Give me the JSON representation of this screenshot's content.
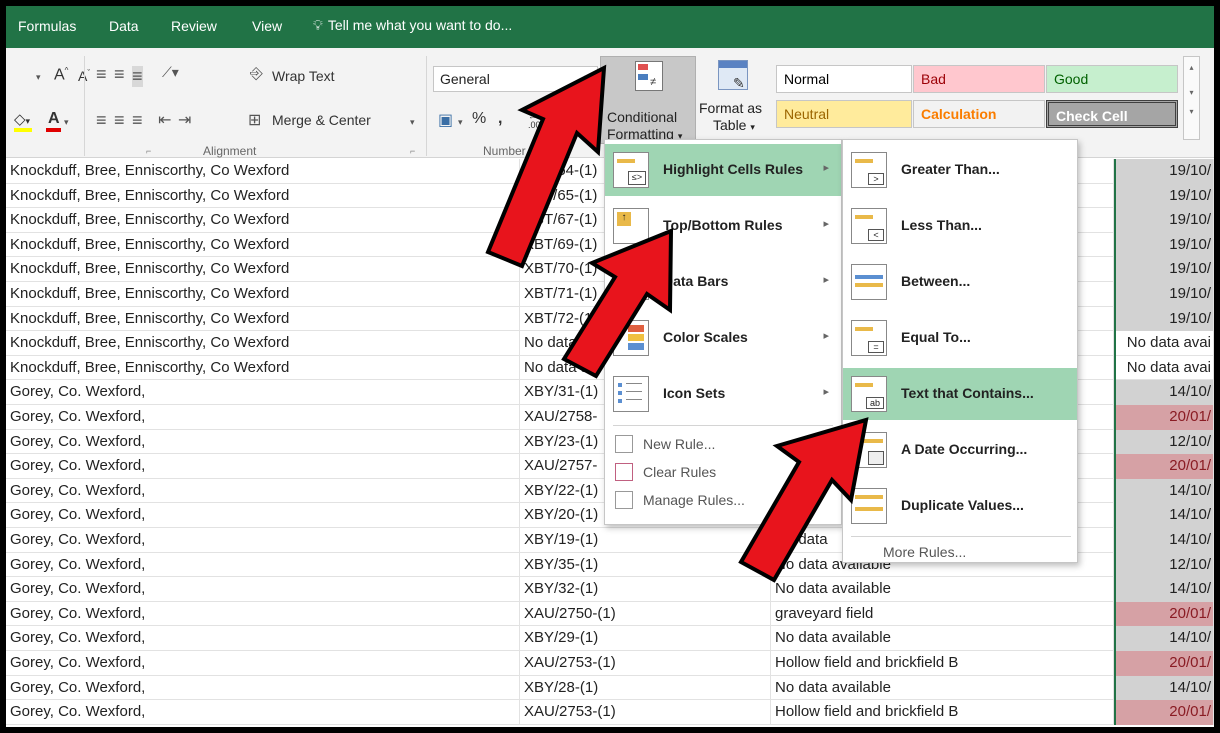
{
  "tabs": [
    "Formulas",
    "Data",
    "Review",
    "View"
  ],
  "tell_me": "Tell me what you want to do...",
  "ribbon": {
    "wrap_text": "Wrap Text",
    "merge_center": "Merge & Center",
    "number_format": "General",
    "cf_label_1": "Conditional",
    "cf_label_2": "Formatting",
    "fat_label_1": "Format as",
    "fat_label_2": "Table",
    "alignment_group": "Alignment",
    "number_group": "Number",
    "percent": "%",
    "comma": ","
  },
  "styles": [
    {
      "label": "Normal",
      "bg": "#ffffff",
      "fg": "#000000"
    },
    {
      "label": "Bad",
      "bg": "#ffc7ce",
      "fg": "#9c0006"
    },
    {
      "label": "Good",
      "bg": "#c6efce",
      "fg": "#006100"
    },
    {
      "label": "Neutral",
      "bg": "#ffeb9c",
      "fg": "#9c6500"
    },
    {
      "label": "Calculation",
      "bg": "#f2f2f2",
      "fg": "#fa7d00"
    },
    {
      "label": "Check Cell",
      "bg": "#a5a5a5",
      "fg": "#ffffff"
    }
  ],
  "menu1": {
    "items": [
      {
        "label": "Highlight Cells Rules",
        "icon": "highlight-cells-icon"
      },
      {
        "label": "Top/Bottom Rules",
        "icon": "top-bottom-icon"
      },
      {
        "label": "Data Bars",
        "icon": "data-bars-icon"
      },
      {
        "label": "Color Scales",
        "icon": "color-scales-icon"
      },
      {
        "label": "Icon Sets",
        "icon": "icon-sets-icon"
      }
    ],
    "small": [
      "New Rule...",
      "Clear Rules",
      "Manage Rules..."
    ]
  },
  "menu2": {
    "items": [
      {
        "label": "Greater Than..."
      },
      {
        "label": "Less Than..."
      },
      {
        "label": "Between..."
      },
      {
        "label": "Equal To..."
      },
      {
        "label": "Text that Contains..."
      },
      {
        "label": "A Date Occurring..."
      },
      {
        "label": "Duplicate Values..."
      }
    ],
    "more": "More Rules..."
  },
  "rows": [
    {
      "a": "Knockduff, Bree, Enniscorthy, Co Wexford",
      "b": "XBT/64-(1)",
      "c": "",
      "d": "19/10/",
      "t": "gray"
    },
    {
      "a": "Knockduff, Bree, Enniscorthy, Co Wexford",
      "b": "XBT/65-(1)",
      "c": "",
      "d": "19/10/",
      "t": "gray"
    },
    {
      "a": "Knockduff, Bree, Enniscorthy, Co Wexford",
      "b": "XBT/67-(1)",
      "c": "",
      "d": "19/10/",
      "t": "gray"
    },
    {
      "a": "Knockduff, Bree, Enniscorthy, Co Wexford",
      "b": "XBT/69-(1)",
      "c": "",
      "d": "19/10/",
      "t": "gray"
    },
    {
      "a": "Knockduff, Bree, Enniscorthy, Co Wexford",
      "b": "XBT/70-(1)",
      "c": "",
      "d": "19/10/",
      "t": "gray"
    },
    {
      "a": "Knockduff, Bree, Enniscorthy, Co Wexford",
      "b": "XBT/71-(1)",
      "c": "",
      "d": "19/10/",
      "t": "gray"
    },
    {
      "a": "Knockduff, Bree, Enniscorthy, Co Wexford",
      "b": "XBT/72-(1)",
      "c": "",
      "d": "19/10/",
      "t": "gray"
    },
    {
      "a": "Knockduff, Bree, Enniscorthy, Co Wexford",
      "b": "No data av",
      "c": "",
      "d": "No data avai",
      "t": ""
    },
    {
      "a": "Knockduff, Bree, Enniscorthy, Co Wexford",
      "b": "No data av",
      "c": "",
      "d": "No data avai",
      "t": ""
    },
    {
      "a": "Gorey, Co. Wexford,",
      "b": "XBY/31-(1)",
      "c": "",
      "d": "14/10/",
      "t": "gray"
    },
    {
      "a": "Gorey, Co. Wexford,",
      "b": "XAU/2758-",
      "c": "",
      "d": "20/01/",
      "t": "red"
    },
    {
      "a": "Gorey, Co. Wexford,",
      "b": "XBY/23-(1)",
      "c": "",
      "d": "12/10/",
      "t": "gray"
    },
    {
      "a": "Gorey, Co. Wexford,",
      "b": "XAU/2757-",
      "c": "",
      "d": "20/01/",
      "t": "red"
    },
    {
      "a": "Gorey, Co. Wexford,",
      "b": "XBY/22-(1)",
      "c": "",
      "d": "14/10/",
      "t": "gray"
    },
    {
      "a": "Gorey, Co. Wexford,",
      "b": "XBY/20-(1)",
      "c": "No data",
      "d": "14/10/",
      "t": "gray"
    },
    {
      "a": "Gorey, Co. Wexford,",
      "b": "XBY/19-(1)",
      "c": "No data",
      "d": "14/10/",
      "t": "gray"
    },
    {
      "a": "Gorey, Co. Wexford,",
      "b": "XBY/35-(1)",
      "c": "No data available",
      "d": "12/10/",
      "t": "gray"
    },
    {
      "a": "Gorey, Co. Wexford,",
      "b": "XBY/32-(1)",
      "c": "No data available",
      "d": "14/10/",
      "t": "gray"
    },
    {
      "a": "Gorey, Co. Wexford,",
      "b": "XAU/2750-(1)",
      "c": "graveyard field",
      "d": "20/01/",
      "t": "red"
    },
    {
      "a": "Gorey, Co. Wexford,",
      "b": "XBY/29-(1)",
      "c": "No data available",
      "d": "14/10/",
      "t": "gray"
    },
    {
      "a": "Gorey, Co. Wexford,",
      "b": "XAU/2753-(1)",
      "c": "Hollow field and brickfield B",
      "d": "20/01/",
      "t": "red"
    },
    {
      "a": "Gorey, Co. Wexford,",
      "b": "XBY/28-(1)",
      "c": "No data available",
      "d": "14/10/",
      "t": "gray"
    },
    {
      "a": "Gorey, Co. Wexford,",
      "b": "XAU/2753-(1)",
      "c": "Hollow field and brickfield B",
      "d": "20/01/",
      "t": "red"
    }
  ]
}
